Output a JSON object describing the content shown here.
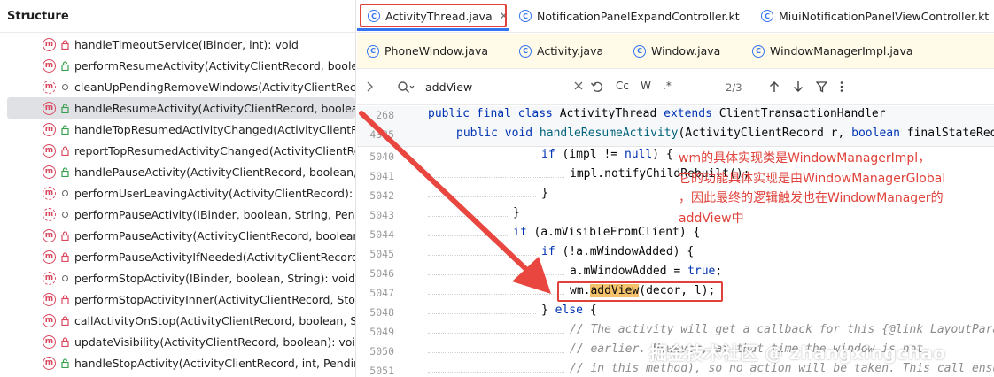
{
  "structure": {
    "title": "Structure",
    "items": [
      {
        "label": "handleTimeoutService(IBinder, int): void",
        "icon": "m",
        "visibility": "private"
      },
      {
        "label": "performResumeActivity(ActivityClientRecord, boolean, S",
        "icon": "m",
        "visibility": "public"
      },
      {
        "label": "cleanUpPendingRemoveWindows(ActivityClientRecord, b",
        "icon": "m-override",
        "visibility": "package"
      },
      {
        "label": "handleResumeActivity(ActivityClientRecord, boolean, bo",
        "icon": "m",
        "visibility": "public",
        "selected": true
      },
      {
        "label": "handleTopResumedActivityChanged(ActivityClientRecor",
        "icon": "m",
        "visibility": "public"
      },
      {
        "label": "reportTopResumedActivityChanged(ActivityClientRecor",
        "icon": "m",
        "visibility": "private"
      },
      {
        "label": "handlePauseActivity(ActivityClientRecord, boolean, boo",
        "icon": "m",
        "visibility": "public"
      },
      {
        "label": "performUserLeavingActivity(ActivityClientRecord): void",
        "icon": "m-override",
        "visibility": "package"
      },
      {
        "label": "performPauseActivity(IBinder, boolean, String, Pending",
        "icon": "m-override",
        "visibility": "package"
      },
      {
        "label": "performPauseActivity(ActivityClientRecord, boolean, Str",
        "icon": "m",
        "visibility": "private"
      },
      {
        "label": "performPauseActivityIfNeeded(ActivityClientRecord, Str",
        "icon": "m",
        "visibility": "private"
      },
      {
        "label": "performStopActivity(IBinder, boolean, String): void",
        "icon": "m-override",
        "visibility": "package"
      },
      {
        "label": "performStopActivityInner(ActivityClientRecord, StopInfo",
        "icon": "m",
        "visibility": "private"
      },
      {
        "label": "callActivityOnStop(ActivityClientRecord, boolean, String",
        "icon": "m",
        "visibility": "private"
      },
      {
        "label": "updateVisibility(ActivityClientRecord, boolean): void",
        "icon": "m",
        "visibility": "private"
      },
      {
        "label": "handleStopActivity(ActivityClientRecord, int, PendingTra",
        "icon": "m",
        "visibility": "public"
      }
    ]
  },
  "tabs_row1": [
    {
      "label": "ActivityThread.java",
      "kind": "java",
      "active": true
    },
    {
      "label": "NotificationPanelExpandController.kt",
      "kind": "java"
    },
    {
      "label": "MiuiNotificationPanelViewController.kt",
      "kind": "java"
    }
  ],
  "tabs_row2": [
    {
      "label": "PhoneWindow.java",
      "kind": "java"
    },
    {
      "label": "Activity.java",
      "kind": "java"
    },
    {
      "label": "Window.java",
      "kind": "java"
    },
    {
      "label": "WindowManagerImpl.java",
      "kind": "java"
    }
  ],
  "find": {
    "query": "addView",
    "count": "2/3",
    "options": [
      "Cc",
      "W",
      ".*"
    ]
  },
  "code": {
    "sticky": [
      {
        "num": "268",
        "text": "public final class ActivityThread extends ClientTransactionHandler"
      },
      {
        "num": "4335",
        "text": "public void handleResumeActivity(ActivityClientRecord r, boolean finalStateRequest"
      }
    ],
    "lines": [
      {
        "num": "5040",
        "text": "if (impl != null) {"
      },
      {
        "num": "5041",
        "text": "impl.notifyChildRebuilt();"
      },
      {
        "num": "5042",
        "text": "}"
      },
      {
        "num": "5043",
        "text": "}"
      },
      {
        "num": "5044",
        "text": "if (a.mVisibleFromClient) {"
      },
      {
        "num": "5045",
        "text": "if (!a.mWindowAdded) {"
      },
      {
        "num": "5046",
        "text": "a.mWindowAdded = true;"
      },
      {
        "num": "5047",
        "text": "wm.addView(decor, l);"
      },
      {
        "num": "5048",
        "text": "} else {"
      },
      {
        "num": "5049",
        "text": "// The activity will get a callback for this {@link LayoutParams"
      },
      {
        "num": "5050",
        "text": "// earlier. However, at that time the window is not"
      },
      {
        "num": "5051",
        "text": "// in this method), so no action will be taken. This call ensures"
      }
    ]
  },
  "annotation": {
    "lines": [
      "wm的具体实现类是WindowManagerImpl，",
      "它的功能具体实现是由WindowManagerGlobal",
      "，因此最终的逻辑触发也在WindowManager的",
      "addView中"
    ],
    "color": "#e0413a"
  },
  "watermark": "掘金技术社区 @ zhangxingchao"
}
